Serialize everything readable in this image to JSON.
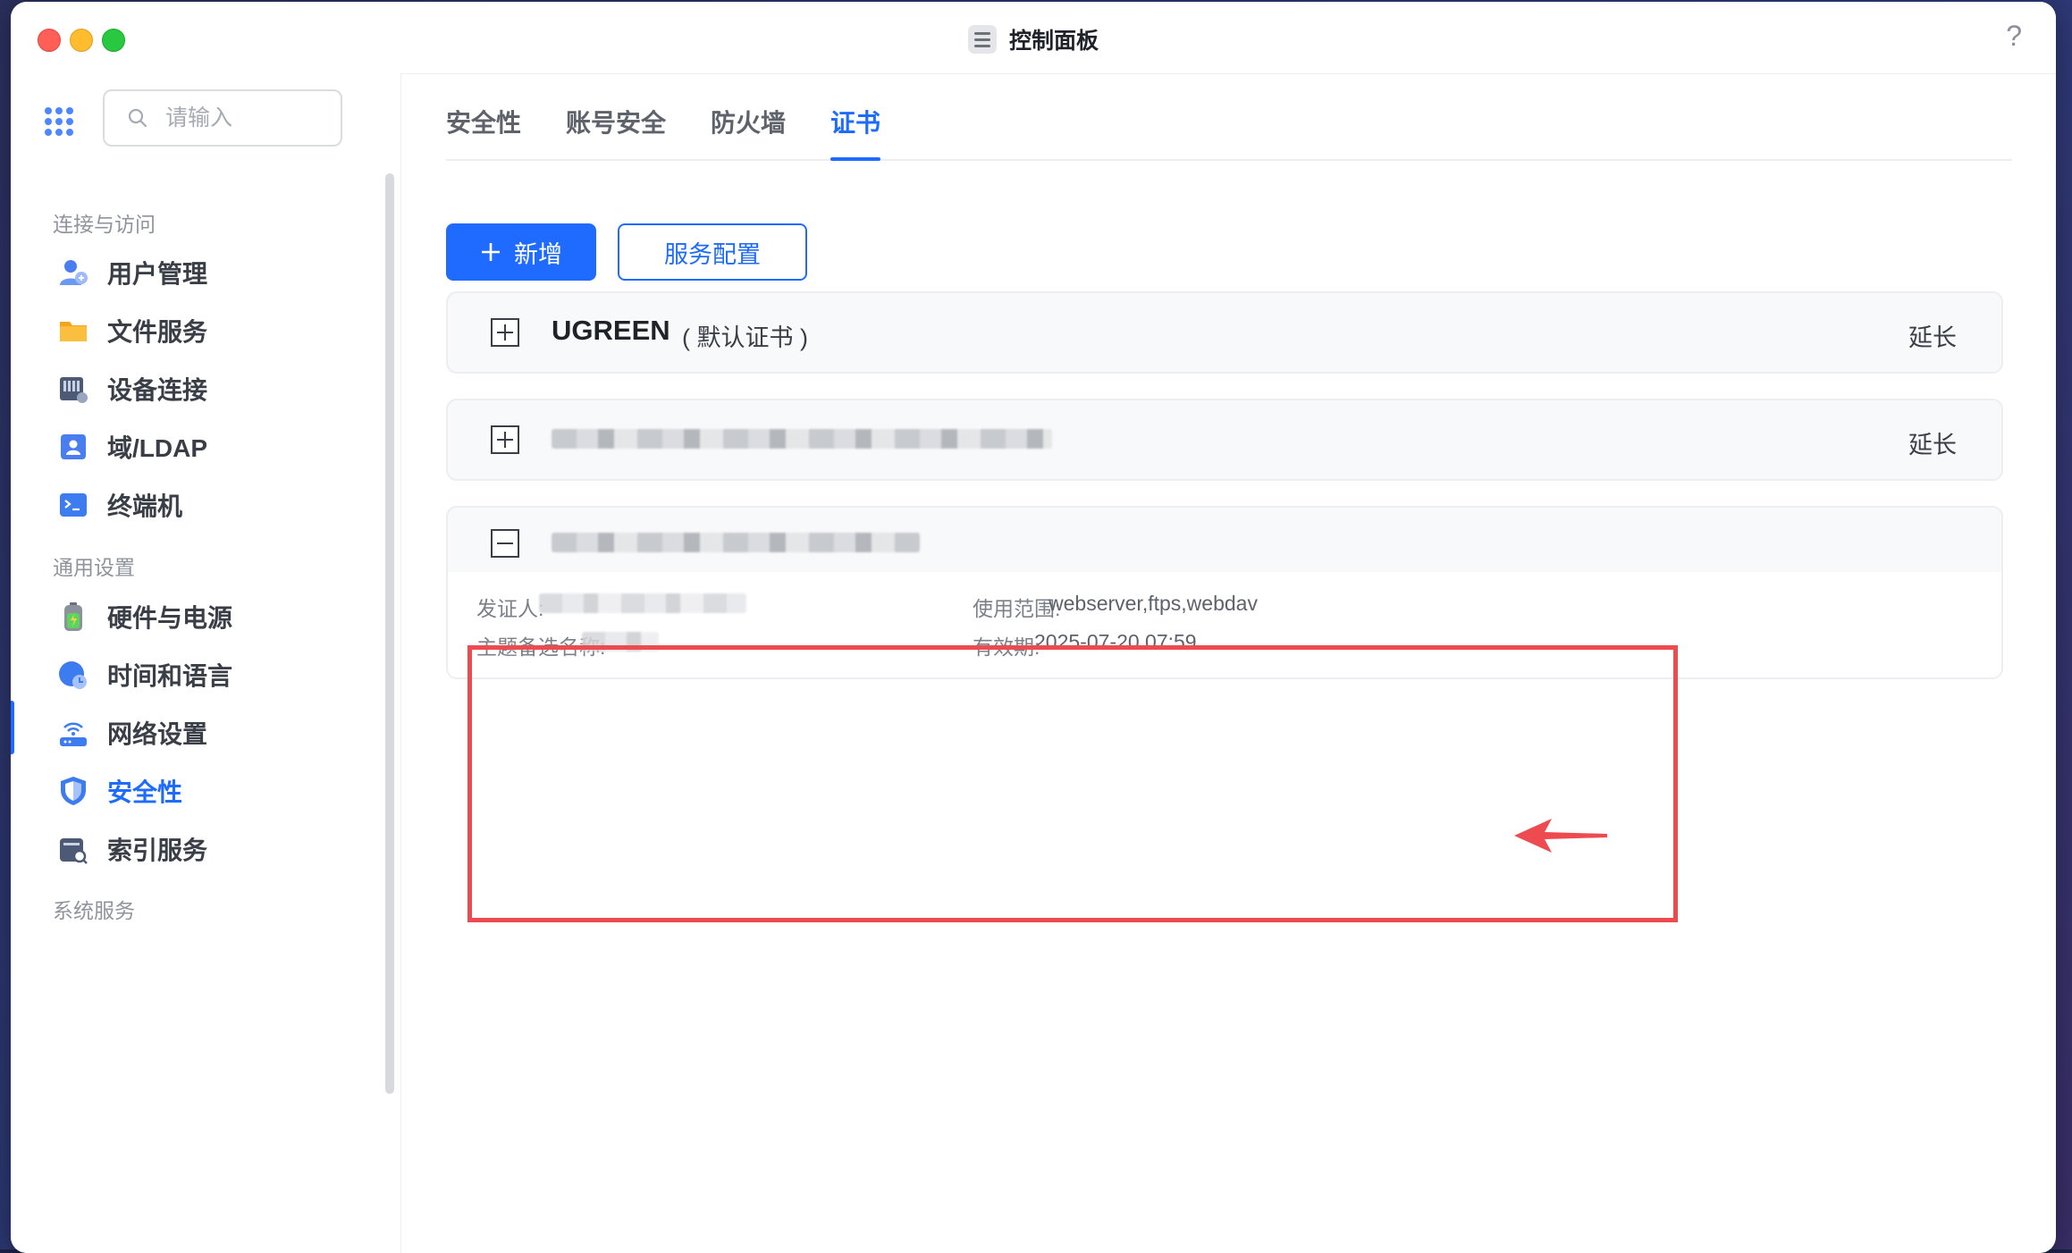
{
  "window": {
    "title": "控制面板",
    "help_label": "?"
  },
  "search": {
    "placeholder": "请输入",
    "value": ""
  },
  "sidebar": {
    "sections": [
      {
        "label": "连接与访问"
      },
      {
        "label": "通用设置"
      },
      {
        "label": "系统服务"
      }
    ],
    "items": [
      {
        "label": "用户管理",
        "icon": "user-management-icon"
      },
      {
        "label": "文件服务",
        "icon": "folder-icon"
      },
      {
        "label": "设备连接",
        "icon": "device-connection-icon"
      },
      {
        "label": "域/LDAP",
        "icon": "ldap-icon"
      },
      {
        "label": "终端机",
        "icon": "terminal-icon"
      },
      {
        "label": "硬件与电源",
        "icon": "battery-icon"
      },
      {
        "label": "时间和语言",
        "icon": "clock-globe-icon"
      },
      {
        "label": "网络设置",
        "icon": "router-icon"
      },
      {
        "label": "安全性",
        "icon": "shield-icon",
        "active": true
      },
      {
        "label": "索引服务",
        "icon": "index-search-icon"
      }
    ]
  },
  "tabs": [
    {
      "label": "安全性"
    },
    {
      "label": "账号安全"
    },
    {
      "label": "防火墙"
    },
    {
      "label": "证书",
      "active": true
    }
  ],
  "toolbar": {
    "add_label": "新增",
    "config_label": "服务配置"
  },
  "certificates": [
    {
      "name": "UGREEN",
      "tag": "( 默认证书 )",
      "action": "延长",
      "expanded": false
    },
    {
      "name": "",
      "tag": "",
      "action": "延长",
      "expanded": false
    },
    {
      "name": "",
      "expanded": true,
      "details": {
        "issuer_label": "发证人:",
        "san_label": "主题备选名称:",
        "scope_label": "使用范围:",
        "scope_value": "webserver,ftps,webdav",
        "validity_label": "有效期:",
        "validity_value": "2025-07-20 07:59"
      }
    }
  ],
  "colors": {
    "accent": "#1f6bff",
    "highlight": "#ee4b50"
  }
}
